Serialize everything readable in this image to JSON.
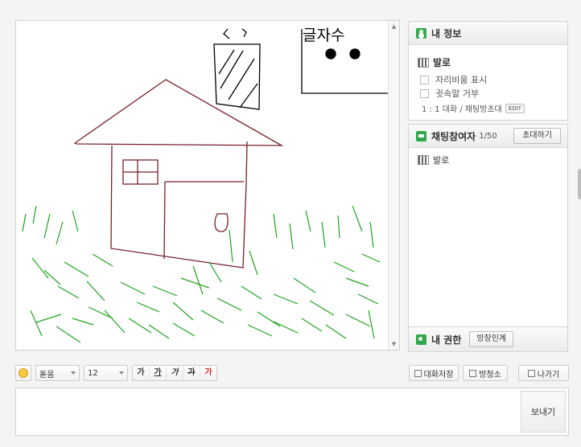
{
  "canvas": {
    "drawn_text": "글자수"
  },
  "my_info": {
    "title": "내 정보",
    "nickname": "발로",
    "option_seat_ratio": "자리비움 표시",
    "option_whisper_reject": "귓속말 거부",
    "dialog_label": "1 : 1 대화 / 채팅방초대",
    "edit_button": "EDIT"
  },
  "participants": {
    "title": "채팅참여자",
    "count": "1/50",
    "invite_button": "초대하기",
    "members": [
      {
        "name": "발로"
      }
    ]
  },
  "permissions": {
    "title": "내 권한",
    "host_delegate_button": "방장인계"
  },
  "toolbar": {
    "font_family_value": "돋움",
    "font_size_value": "12",
    "style_bold": "가",
    "style_underline": "가",
    "style_italic": "가",
    "style_strike": "가",
    "style_color": "가",
    "save_chat_button": "대화저장",
    "announce_button": "방청소",
    "exit_button": "나가기"
  },
  "input": {
    "send_button": "보내기"
  },
  "colors": {
    "accent_green": "#2fa84a",
    "house_stroke": "#7a1f2b",
    "grass_stroke": "#1ea31e"
  },
  "icons": [
    "smiley-icon",
    "user-icon",
    "chat-icon",
    "key-icon",
    "save-icon",
    "broom-icon",
    "exit-icon",
    "scroll-up-icon",
    "scroll-down-icon"
  ]
}
